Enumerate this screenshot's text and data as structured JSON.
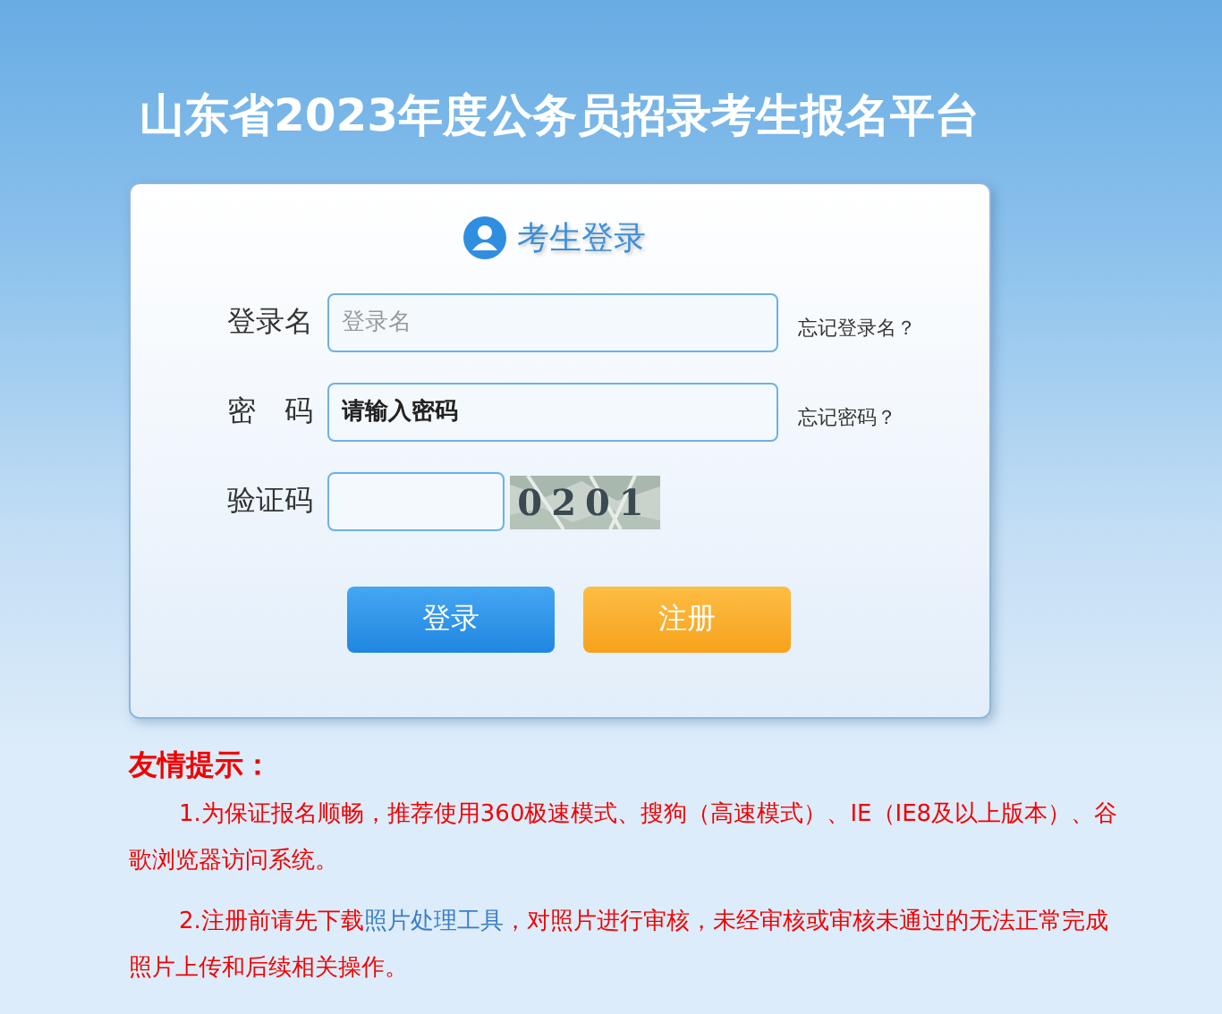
{
  "header": {
    "title": "山东省2023年度公务员招录考生报名平台"
  },
  "login": {
    "title": "考生登录",
    "fields": [
      {
        "label": "登录名",
        "placeholder": "登录名",
        "link": "忘记登录名？",
        "kind": "text"
      },
      {
        "label": "密　码",
        "placeholder": "请输入密码",
        "link": "忘记密码？",
        "kind": "password"
      },
      {
        "label": "验证码",
        "kind": "captcha",
        "captcha": "0201"
      }
    ],
    "buttons": [
      {
        "label": "登录",
        "kind": "primary"
      },
      {
        "label": "注册",
        "kind": "secondary"
      }
    ]
  },
  "notice": {
    "title": "友情提示：",
    "items": [
      {
        "text": "1.为保证报名顺畅，推荐使用360极速模式、搜狗（高速模式）、IE（IE8及以上版本）、谷歌浏览器访问系统。"
      },
      {
        "before": "2.注册前请先下载",
        "link": "照片处理工具",
        "after": "，对照片进行审核，未经审核或审核未通过的无法正常完成照片上传和后续相关操作。"
      }
    ]
  }
}
